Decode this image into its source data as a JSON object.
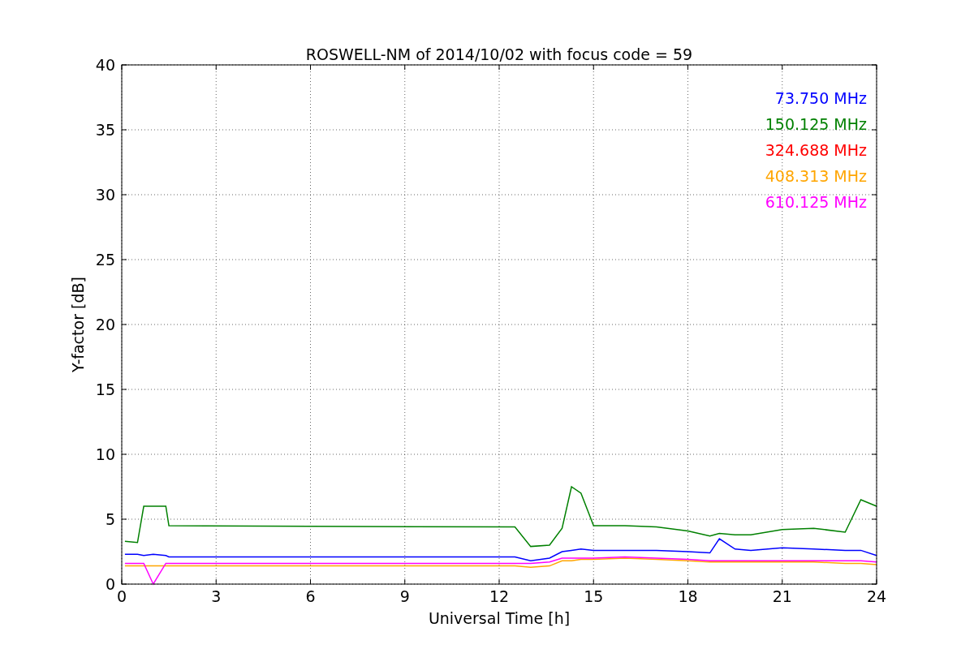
{
  "figure": {
    "chart_data": {
      "type": "line",
      "title": "ROSWELL-NM of 2014/10/02 with focus code = 59",
      "xlabel": "Universal Time [h]",
      "ylabel": "Y-factor [dB]",
      "x": [
        0.1,
        0.5,
        0.7,
        1.0,
        1.4,
        1.5,
        12.5,
        13.0,
        13.6,
        14.0,
        14.3,
        14.6,
        15,
        16,
        17,
        18,
        18.7,
        19,
        19.5,
        20,
        21,
        22,
        23,
        23.5,
        24
      ],
      "series": [
        {
          "name": "73.750 MHz",
          "color": "#0000ff",
          "values": [
            2.3,
            2.3,
            2.2,
            2.3,
            2.2,
            2.1,
            2.1,
            1.8,
            2.0,
            2.5,
            2.6,
            2.7,
            2.6,
            2.6,
            2.6,
            2.5,
            2.4,
            3.5,
            2.7,
            2.6,
            2.8,
            2.7,
            2.6,
            2.6,
            2.2
          ]
        },
        {
          "name": "150.125 MHz",
          "color": "#008000",
          "values": [
            3.3,
            3.2,
            6.0,
            6.0,
            6.0,
            4.5,
            4.4,
            2.9,
            3.0,
            4.3,
            7.5,
            7.0,
            4.5,
            4.5,
            4.4,
            4.1,
            3.7,
            3.9,
            3.8,
            3.8,
            4.2,
            4.3,
            4.0,
            6.5,
            6.0
          ]
        },
        {
          "name": "324.688 MHz",
          "color": "#ff0000",
          "values": [
            null,
            null,
            null,
            null,
            null,
            null,
            null,
            null,
            null,
            null,
            null,
            null,
            null,
            null,
            null,
            null,
            null,
            null,
            null,
            null,
            null,
            null,
            null,
            null,
            null
          ]
        },
        {
          "name": "408.313 MHz",
          "color": "#ffa500",
          "values": [
            1.4,
            1.4,
            1.4,
            1.4,
            1.4,
            1.4,
            1.4,
            1.3,
            1.4,
            1.8,
            1.8,
            1.9,
            1.9,
            2.0,
            1.9,
            1.8,
            1.7,
            1.7,
            1.7,
            1.7,
            1.7,
            1.7,
            1.6,
            1.6,
            1.5
          ]
        },
        {
          "name": "610.125 MHz",
          "color": "#ff00ff",
          "values": [
            1.6,
            1.6,
            1.6,
            0,
            1.6,
            1.6,
            1.6,
            1.6,
            1.7,
            2.0,
            2.0,
            2.0,
            2.0,
            2.1,
            2.0,
            1.9,
            1.8,
            1.8,
            1.8,
            1.8,
            1.8,
            1.8,
            1.8,
            1.8,
            1.7
          ]
        }
      ],
      "grid": true,
      "xlim": [
        0,
        24
      ],
      "ylim": [
        0,
        40
      ],
      "xticks": [
        0,
        3,
        6,
        9,
        12,
        15,
        18,
        21,
        24
      ],
      "yticks": [
        0,
        5,
        10,
        15,
        20,
        25,
        30,
        35,
        40
      ]
    }
  }
}
